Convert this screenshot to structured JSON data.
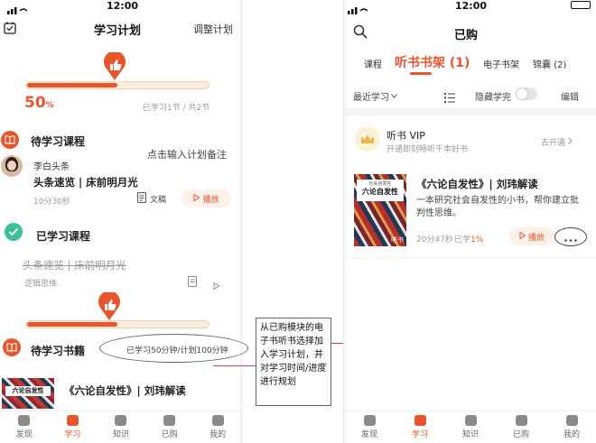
{
  "left": {
    "status_time": "12:00",
    "header": {
      "title": "学习计划",
      "action": "调整计划"
    },
    "progress": {
      "percent_text": "50",
      "percent_sign": "%",
      "fraction": 0.5,
      "stat": "已学习1节 / 共2节"
    },
    "pending_course": {
      "heading": "待学习课程",
      "note_hint": "点击输入计划备注",
      "author": "李白头条",
      "title": "头条速览 | 床前明月光",
      "duration": "10分30秒",
      "doc_label": "文稿",
      "play_label": "播放"
    },
    "learned_course": {
      "heading": "已学习课程",
      "title": "头条速览 | 床前明月光",
      "subtitle": "逻辑思维"
    },
    "book_progress": {
      "fraction": 0.5
    },
    "pending_book": {
      "heading": "待学习书籍",
      "plan_text": "已学习50分钟/计划100分钟",
      "title": "《六论自发性》| 刘玮解读"
    },
    "tabs": [
      {
        "label": "发现",
        "active": false
      },
      {
        "label": "学习",
        "active": true
      },
      {
        "label": "知识",
        "active": false
      },
      {
        "label": "已购",
        "active": false
      },
      {
        "label": "我的",
        "active": false
      }
    ]
  },
  "annotation": {
    "text": "从已购模块的电子书听书选择加入学习计划，并对学习时间/进度进行规划"
  },
  "right": {
    "status_time": "12:00",
    "header": {
      "title": "已购"
    },
    "categories": [
      {
        "label": "课程",
        "active": false
      },
      {
        "label": "听书书架",
        "count": "(1)",
        "active": true
      },
      {
        "label": "电子书架",
        "active": false
      },
      {
        "label": "锦囊",
        "count": "(2)",
        "active": false
      }
    ],
    "toolbar": {
      "sort": "最近学习",
      "hide_label": "隐藏学完",
      "edit": "编辑"
    },
    "vip": {
      "title": "听书 VIP",
      "subtitle": "开通即刻畅听千本好书",
      "action": "去开通"
    },
    "book": {
      "title": "《六论自发性》| 刘玮解读",
      "desc": "一本研究社会自发性的小书，帮你建立批判性思维。",
      "duration": "20分47秒",
      "learned_prefix": "已学",
      "learned_percent": "1%",
      "play_label": "播放",
      "cover_top": "社会自发性",
      "cover_title": "六论自发性",
      "cover_sub": "听书"
    },
    "tabs": [
      {
        "label": "发现",
        "active": false
      },
      {
        "label": "学习",
        "active": true
      },
      {
        "label": "知识",
        "active": false
      },
      {
        "label": "已购",
        "active": false
      },
      {
        "label": "我的",
        "active": false
      }
    ]
  },
  "colors": {
    "accent": "#e8542b",
    "teal": "#3cbf9a",
    "annotation_line": "#cc4444"
  }
}
